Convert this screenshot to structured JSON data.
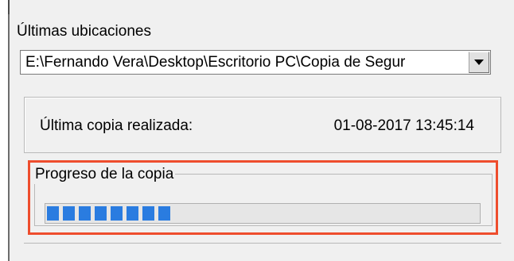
{
  "locations": {
    "label": "Últimas ubicaciones",
    "selected_path": "E:\\Fernando Vera\\Desktop\\Escritorio PC\\Copia de Segur",
    "dropdown_icon": "chevron-down-icon"
  },
  "last_copy": {
    "label": "Última copia realizada:",
    "value": "01-08-2017 13:45:14"
  },
  "progress": {
    "label": "Progreso de la copia",
    "percent": 30,
    "chunks": 8,
    "color": "#2a7ce0"
  },
  "colors": {
    "panel_bg": "#f0f0f0",
    "highlight": "#ee4d2d",
    "progress_fill": "#2a7ce0"
  }
}
